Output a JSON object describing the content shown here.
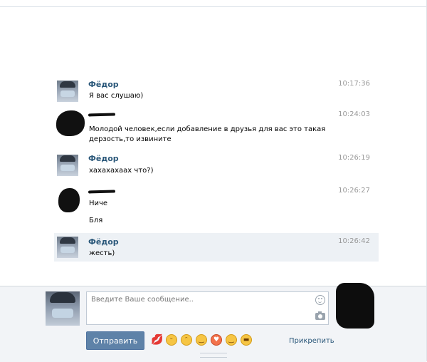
{
  "messages": [
    {
      "author": "Фёдор",
      "time": "10:17:36",
      "lines": [
        "Я вас слушаю)"
      ],
      "avatar": "user-photo"
    },
    {
      "author": "",
      "time": "10:24:03",
      "lines": [
        "Молодой человек,если добавление в друзья для вас это такая",
        "дерзость,то извините"
      ],
      "avatar": "scribbled-out"
    },
    {
      "author": "Фёдор",
      "time": "10:26:19",
      "lines": [
        "хахахахаах что?)"
      ],
      "avatar": "user-photo"
    },
    {
      "author": "",
      "time": "10:26:27",
      "lines": [
        "Ниче",
        "Бля"
      ],
      "avatar": "scribbled-out"
    },
    {
      "author": "Фёдор",
      "time": "10:26:42",
      "lines": [
        "жесть)"
      ],
      "avatar": "user-photo",
      "highlighted": true
    }
  ],
  "composer": {
    "placeholder": "Введите Ваше сообщение..",
    "value": "",
    "send_label": "Отправить",
    "attach_label": "Прикрепить",
    "emojis": [
      "kiss-emoji",
      "grin-emoji",
      "wink-kiss-emoji",
      "blush-emoji",
      "heart-eyes-emoji",
      "smile-emoji",
      "sunglasses-emoji"
    ],
    "accent_color": "#5e82a8",
    "link_color": "#2b587a"
  }
}
